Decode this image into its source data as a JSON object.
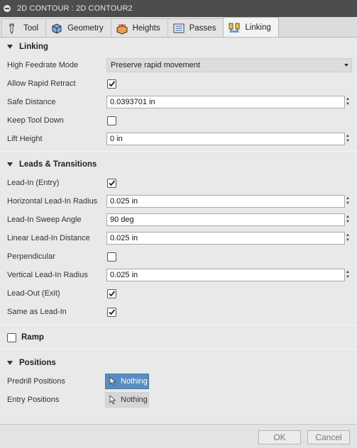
{
  "window": {
    "title": "2D CONTOUR : 2D CONTOUR2"
  },
  "tabs": [
    {
      "label": "Tool",
      "icon": "tool-icon"
    },
    {
      "label": "Geometry",
      "icon": "geometry-icon"
    },
    {
      "label": "Heights",
      "icon": "heights-icon"
    },
    {
      "label": "Passes",
      "icon": "passes-icon"
    },
    {
      "label": "Linking",
      "icon": "linking-icon",
      "active": true
    }
  ],
  "linking": {
    "title": "Linking",
    "high_feedrate_mode": {
      "label": "High Feedrate Mode",
      "value": "Preserve rapid movement"
    },
    "allow_rapid_retract": {
      "label": "Allow Rapid Retract",
      "checked": true
    },
    "safe_distance": {
      "label": "Safe Distance",
      "value": "0.0393701 in"
    },
    "keep_tool_down": {
      "label": "Keep Tool Down",
      "checked": false
    },
    "lift_height": {
      "label": "Lift Height",
      "value": "0 in"
    }
  },
  "leads": {
    "title": "Leads & Transitions",
    "lead_in": {
      "label": "Lead-In (Entry)",
      "checked": true
    },
    "horizontal_lead_in_radius": {
      "label": "Horizontal Lead-In Radius",
      "value": "0.025 in"
    },
    "lead_in_sweep_angle": {
      "label": "Lead-In Sweep Angle",
      "value": "90 deg"
    },
    "linear_lead_in_distance": {
      "label": "Linear Lead-In Distance",
      "value": "0.025 in"
    },
    "perpendicular": {
      "label": "Perpendicular",
      "checked": false
    },
    "vertical_lead_in_radius": {
      "label": "Vertical Lead-In Radius",
      "value": "0.025 in"
    },
    "lead_out": {
      "label": "Lead-Out (Exit)",
      "checked": true
    },
    "same_as_lead_in": {
      "label": "Same as Lead-In",
      "checked": true
    }
  },
  "ramp": {
    "title": "Ramp",
    "checked": false
  },
  "positions": {
    "title": "Positions",
    "predrill": {
      "label": "Predrill Positions",
      "button": "Nothing"
    },
    "entry": {
      "label": "Entry Positions",
      "button": "Nothing"
    }
  },
  "footer": {
    "ok": "OK",
    "cancel": "Cancel"
  },
  "colors": {
    "accent": "#5a8dbf",
    "titlebar": "#4d4d4d",
    "panel": "#e9e9e9"
  }
}
